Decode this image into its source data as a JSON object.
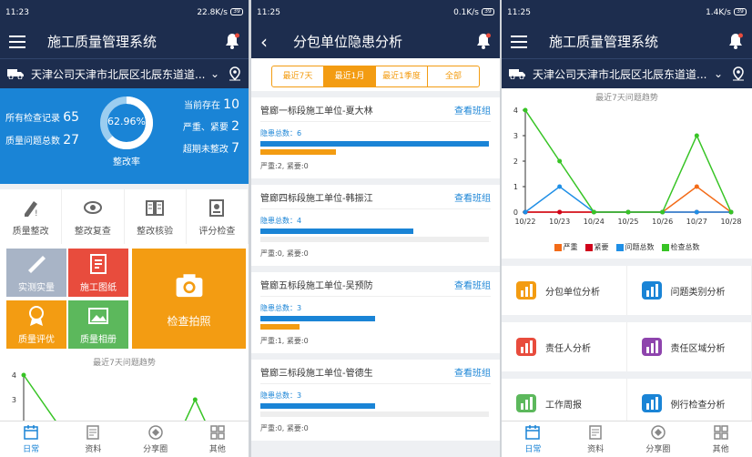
{
  "screens": {
    "home": {
      "status": {
        "time": "11:23",
        "speed": "22.8K/s",
        "battery": "39"
      },
      "title": "施工质量管理系统",
      "location": "天津公司天津市北辰区北辰东道道...",
      "stats": {
        "all_label": "所有检查记录",
        "all_value": "65",
        "problem_label": "质量问题总数",
        "problem_value": "27",
        "percent": "62.96%",
        "rate_label": "整改率",
        "exist_label": "当前存在",
        "exist_value": "10",
        "urgent_label": "严重、紧要",
        "urgent_value": "2",
        "overdue_label": "超期未整改",
        "overdue_value": "7"
      },
      "actions": [
        "质量整改",
        "整改复查",
        "整改核验",
        "评分检查"
      ],
      "tiles": {
        "survey": "实测实量",
        "drawing": "施工图纸",
        "photo": "检查拍照",
        "eval": "质量评优",
        "album": "质量相册"
      },
      "trend_title": "最近7天问题趋势",
      "chart_data": {
        "type": "line",
        "title": "最近7天问题趋势",
        "ylim": [
          0,
          4
        ],
        "yticks": [
          "4",
          "3"
        ],
        "series": [
          {
            "values": [
              4,
              2,
              0
            ],
            "color": "#37c425"
          },
          {
            "values": [
              0,
              0,
              0
            ],
            "color": "#37c425",
            "offset": 6,
            "value_at_6": 1
          }
        ]
      }
    },
    "analysis": {
      "status": {
        "time": "11:25",
        "speed": "0.1K/s",
        "battery": "39"
      },
      "title": "分包单位隐患分析",
      "tabs": [
        "最近7天",
        "最近1月",
        "最近1季度",
        "全部"
      ],
      "active_tab": 1,
      "view_label": "查看班组",
      "count_prefix": "隐患总数：",
      "cards": [
        {
          "name": "管廊一标段施工单位-夏大林",
          "count": "6",
          "detail": "严重:2, 紧要:0",
          "blue": 1.0,
          "orange": 0.33
        },
        {
          "name": "管廊四标段施工单位-韩振江",
          "count": "4",
          "detail": "严重:0, 紧要:0",
          "blue": 0.67,
          "orange": 0
        },
        {
          "name": "管廊五标段施工单位-吴预防",
          "count": "3",
          "detail": "严重:1, 紧要:0",
          "blue": 0.5,
          "orange": 0.17
        },
        {
          "name": "管廊三标段施工单位-管德生",
          "count": "3",
          "detail": "严重:0, 紧要:0",
          "blue": 0.5,
          "orange": 0
        }
      ]
    },
    "home2": {
      "status": {
        "time": "11:25",
        "speed": "1.4K/s",
        "battery": "39"
      },
      "title": "施工质量管理系统",
      "location": "天津公司天津市北辰区北辰东道道...",
      "trend_title": "最近7天问题趋势",
      "menus": [
        [
          "分包单位分析",
          "问题类别分析"
        ],
        [
          "责任人分析",
          "责任区域分析"
        ],
        [
          "工作周报",
          "例行检查分析"
        ]
      ]
    }
  },
  "nav": [
    "日常",
    "资料",
    "分享圈",
    "其他"
  ],
  "chart_data": {
    "type": "line",
    "title": "最近7天问题趋势",
    "x": [
      "10/22",
      "10/23",
      "10/24",
      "10/25",
      "10/26",
      "10/27",
      "10/28"
    ],
    "ylim": [
      0,
      4
    ],
    "yticks": [
      0,
      1,
      2,
      3,
      4
    ],
    "series": [
      {
        "name": "严重",
        "color": "#f36b18",
        "values": [
          0,
          0,
          0,
          0,
          0,
          1,
          0
        ]
      },
      {
        "name": "紧要",
        "color": "#d0021b",
        "values": [
          0,
          0,
          0,
          0,
          0,
          0,
          0
        ]
      },
      {
        "name": "问题总数",
        "color": "#1f8fe6",
        "values": [
          0,
          1,
          0,
          0,
          0,
          0,
          0
        ]
      },
      {
        "name": "检查总数",
        "color": "#37c425",
        "values": [
          4,
          2,
          0,
          0,
          0,
          3,
          0
        ]
      }
    ]
  },
  "colors": {
    "navy": "#1d2d4e",
    "blue": "#1a84d6",
    "orange": "#f39c12",
    "red": "#e84c3d",
    "green": "#5cb85c",
    "grey": "#a8b4c6"
  }
}
